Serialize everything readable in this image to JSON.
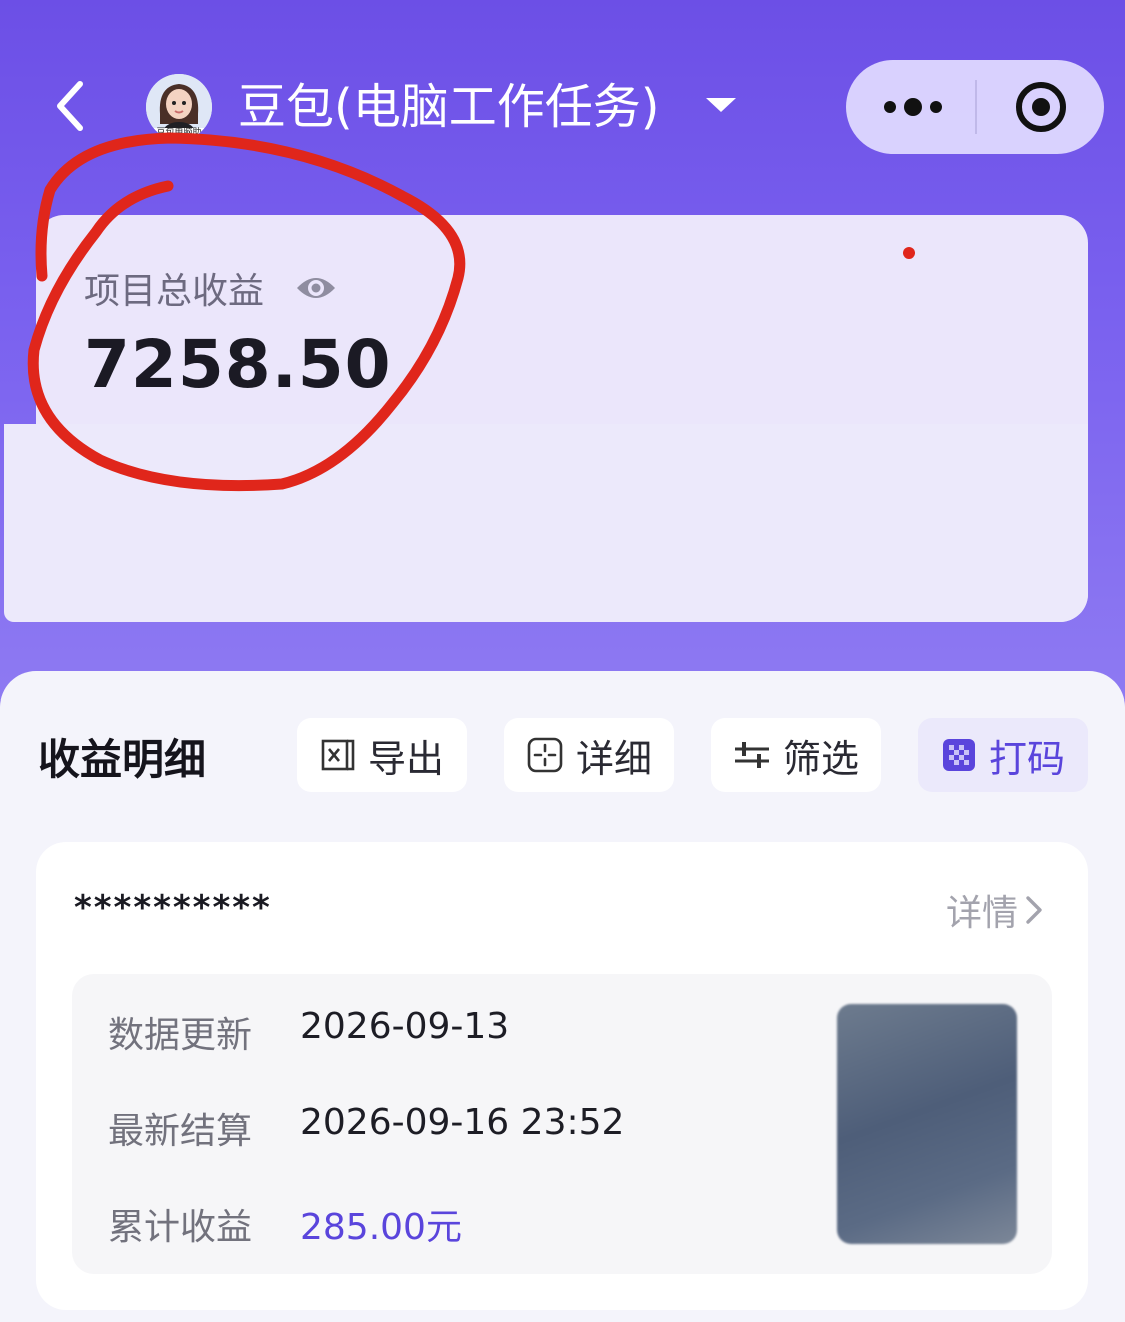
{
  "header": {
    "title": "豆包(电脑工作任务)",
    "avatar_caption": "豆包电脑助",
    "icons": [
      "back-icon",
      "chevron-down-icon",
      "more-icon",
      "target-icon"
    ]
  },
  "summary": {
    "label": "项目总收益",
    "total": "7258.50"
  },
  "earnings": {
    "section_title": "收益明细",
    "buttons": [
      {
        "label": "导出",
        "icon": "export-icon"
      },
      {
        "label": "详细",
        "icon": "detail-icon"
      },
      {
        "label": "筛选",
        "icon": "filter-icon"
      },
      {
        "label": "打码",
        "icon": "mosaic-icon"
      }
    ],
    "record": {
      "name": "**********",
      "detail_link": "详情",
      "rows": [
        {
          "label": "数据更新",
          "value": "2026-09-13"
        },
        {
          "label": "最新结算",
          "value": "2026-09-16 23:52"
        },
        {
          "label": "累计收益",
          "value": "285.00元"
        }
      ]
    }
  },
  "colors": {
    "header_bg": "#6c4fe6",
    "accent": "#5a45dc",
    "annotation": "#e0261b"
  }
}
